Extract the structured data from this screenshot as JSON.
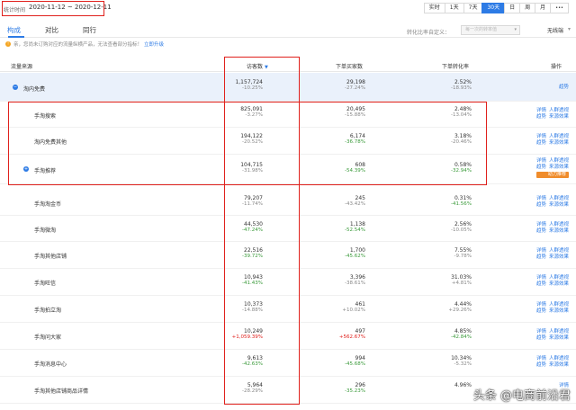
{
  "header": {
    "date_label": "统计时间",
    "date_range": "2020-11-12 ~ 2020-12-11",
    "periods": [
      "实时",
      "1天",
      "7天",
      "30天",
      "日",
      "周",
      "月"
    ],
    "active_period": "30天",
    "more_icon": "ellipsis-icon"
  },
  "tabs": [
    "构成",
    "对比",
    "同行"
  ],
  "compare": {
    "label": "转化比率自定义：",
    "select_placeholder": "每一次的转率值",
    "option": "无线端"
  },
  "notice": {
    "text": "亲，您尚未订购对应的流量纵横产品，无法查看部分指标！",
    "link": "立即升级"
  },
  "table": {
    "headers": {
      "source": "流量来源",
      "visitors": "访客数",
      "buyers": "下单买家数",
      "rate": "下单转化率",
      "ops": "操作"
    },
    "rows": [
      {
        "name": "淘内免费",
        "visitors": "1,157,724",
        "visitors_change": "-10.25%",
        "buyers": "29,198",
        "buyers_change": "-27.24%",
        "rate": "2.52%",
        "rate_change": "-18.93%",
        "ops": [
          "趋势"
        ]
      },
      {
        "name": "手淘搜索",
        "visitors": "825,091",
        "visitors_change": "-3.27%",
        "buyers": "20,495",
        "buyers_change": "-15.88%",
        "rate": "2.48%",
        "rate_change": "-13.04%",
        "ops": [
          "详情",
          "人群透视",
          "趋势",
          "来源效果"
        ]
      },
      {
        "name": "淘内免费其他",
        "visitors": "194,122",
        "visitors_change": "-20.52%",
        "buyers": "6,174",
        "buyers_change": "-36.78%",
        "rate": "3.18%",
        "rate_change": "-20.46%",
        "ops": [
          "详情",
          "人群透视",
          "趋势",
          "来源效果"
        ]
      },
      {
        "name": "手淘推荐",
        "visitors": "104,715",
        "visitors_change": "-31.98%",
        "buyers": "608",
        "buyers_change": "-54.39%",
        "rate": "0.58%",
        "rate_change": "-32.94%",
        "ops": [
          "详情",
          "人群透视",
          "趋势",
          "来源效果"
        ],
        "badge": "助力推荐"
      },
      {
        "name": "手淘淘金币",
        "visitors": "79,207",
        "visitors_change": "-11.74%",
        "buyers": "245",
        "buyers_change": "-43.42%",
        "rate": "0.31%",
        "rate_change": "-41.56%",
        "ops": [
          "详情",
          "人群透视",
          "趋势",
          "来源效果"
        ]
      },
      {
        "name": "手淘微淘",
        "visitors": "44,530",
        "visitors_change": "-47.24%",
        "buyers": "1,138",
        "buyers_change": "-52.54%",
        "rate": "2.56%",
        "rate_change": "-10.05%",
        "ops": [
          "详情",
          "人群透视",
          "趋势",
          "来源效果"
        ]
      },
      {
        "name": "手淘其他店铺",
        "visitors": "22,516",
        "visitors_change": "-39.72%",
        "buyers": "1,700",
        "buyers_change": "-45.62%",
        "rate": "7.55%",
        "rate_change": "-9.78%",
        "ops": [
          "详情",
          "人群透视",
          "趋势",
          "来源效果"
        ]
      },
      {
        "name": "手淘旺信",
        "visitors": "10,943",
        "visitors_change": "-41.43%",
        "buyers": "3,396",
        "buyers_change": "-38.61%",
        "rate": "31.03%",
        "rate_change": "+4.81%",
        "ops": [
          "详情",
          "人群透视",
          "趋势",
          "来源效果"
        ]
      },
      {
        "name": "手淘拍立淘",
        "visitors": "10,373",
        "visitors_change": "-14.88%",
        "buyers": "461",
        "buyers_change": "+10.02%",
        "rate": "4.44%",
        "rate_change": "+29.26%",
        "ops": [
          "详情",
          "人群透视",
          "趋势",
          "来源效果"
        ]
      },
      {
        "name": "手淘问大家",
        "visitors": "10,249",
        "visitors_change": "+1,059.39%",
        "buyers": "497",
        "buyers_change": "+562.67%",
        "rate": "4.85%",
        "rate_change": "-42.84%",
        "ops": [
          "详情",
          "人群透视",
          "趋势",
          "来源效果"
        ]
      },
      {
        "name": "手淘消息中心",
        "visitors": "9,613",
        "visitors_change": "-42.63%",
        "buyers": "994",
        "buyers_change": "-45.68%",
        "rate": "10.34%",
        "rate_change": "-5.32%",
        "ops": [
          "详情",
          "人群透视",
          "趋势",
          "来源效果"
        ]
      },
      {
        "name": "手淘其他店铺商品详情",
        "visitors": "5,964",
        "visitors_change": "-28.29%",
        "buyers": "296",
        "buyers_change": "-35.23%",
        "rate": "4.96%",
        "rate_change": "",
        "ops": [
          "详情"
        ]
      }
    ]
  },
  "watermark": "头条 @电商前沿君"
}
